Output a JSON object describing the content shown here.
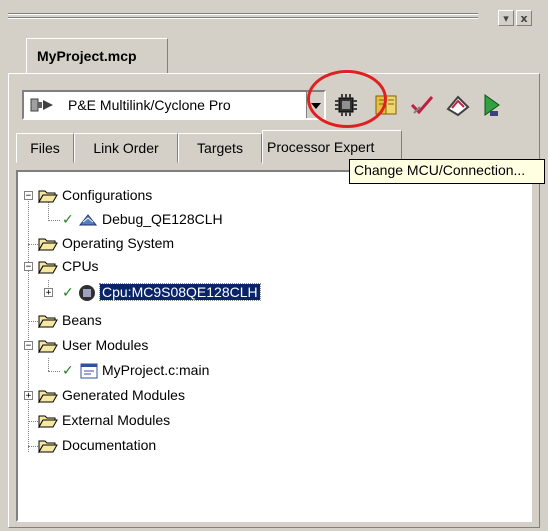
{
  "window": {
    "file_tab": "MyProject.mcp",
    "pin_label": "▾",
    "close_label": "x"
  },
  "toolbar": {
    "connection_combo": "P&E Multilink/Cyclone Pro",
    "tooltip": "Change MCU/Connection..."
  },
  "tabs": [
    {
      "label": "Files"
    },
    {
      "label": "Link Order"
    },
    {
      "label": "Targets"
    },
    {
      "label": "Processor Expert"
    }
  ],
  "tree": {
    "configurations": "Configurations",
    "debug_config": "Debug_QE128CLH",
    "operating_system": "Operating System",
    "cpus": "CPUs",
    "cpu_item": "Cpu:MC9S08QE128CLH",
    "beans": "Beans",
    "user_modules": "User Modules",
    "user_module_main": "MyProject.c:main",
    "generated_modules": "Generated Modules",
    "external_modules": "External Modules",
    "documentation": "Documentation"
  },
  "colors": {
    "accent": "#0a246a",
    "highlight_circle": "#e02020",
    "panel": "#d4d0c8"
  }
}
